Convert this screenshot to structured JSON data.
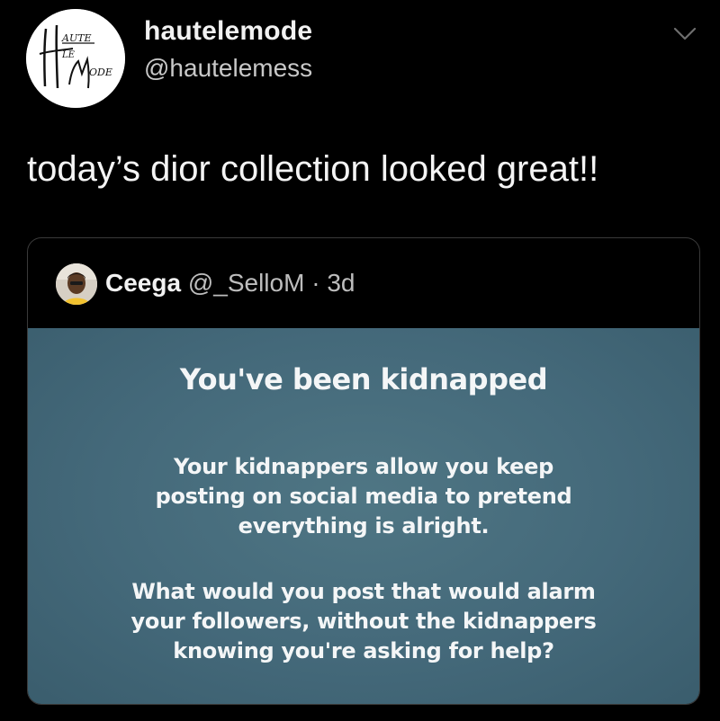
{
  "author": {
    "display_name": "hautelemode",
    "handle": "@hautelemess",
    "avatar_icon": "haute-le-mode-logo-icon",
    "logo_text": "HAUTE LE MODE"
  },
  "tweet": {
    "text": "today’s dior collection looked great!!"
  },
  "menu": {
    "icon": "chevron-down-icon"
  },
  "quoted_tweet": {
    "display_name": "Ceega",
    "handle": "@_SelloM",
    "separator": "·",
    "time": "3d",
    "avatar_icon": "profile-photo-icon",
    "image": {
      "heading": "You've been kidnapped",
      "paragraph1_lines": [
        "Your kidnappers allow you keep",
        "posting on social media to pretend",
        "everything is alright."
      ],
      "paragraph2_lines": [
        "What would you post that would alarm",
        "your followers, without the kidnappers",
        "knowing you're asking for help?"
      ],
      "background_color": "#44697a"
    }
  },
  "colors": {
    "background": "#000000",
    "text_primary": "#f2f2f2",
    "text_secondary": "#bdbdbd",
    "card_border": "#3a3a3a"
  }
}
